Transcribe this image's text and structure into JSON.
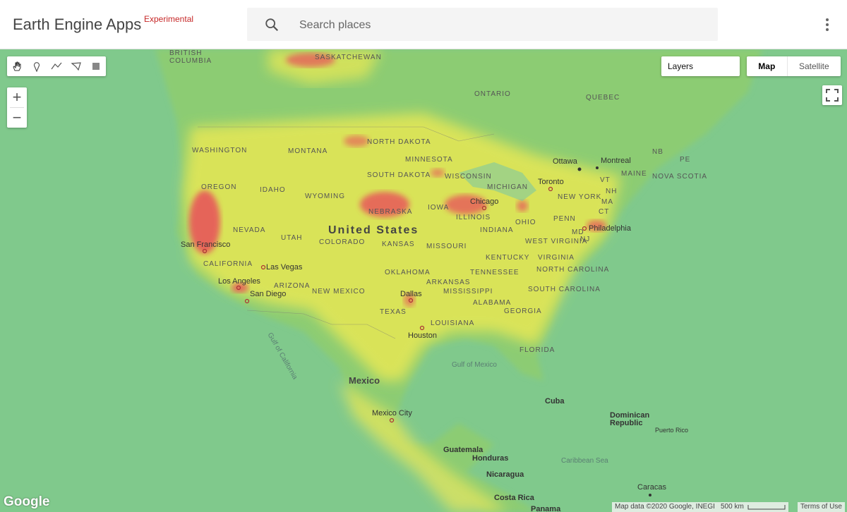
{
  "app": {
    "title": "Earth Engine Apps",
    "badge": "Experimental"
  },
  "search": {
    "placeholder": "Search places"
  },
  "controls": {
    "layers_label": "Layers",
    "map_type": {
      "map": "Map",
      "satellite": "Satellite",
      "selected": "Map"
    },
    "zoom_in": "+",
    "zoom_out": "−"
  },
  "draw_tools": [
    "hand-icon",
    "marker-icon",
    "polyline-icon",
    "polygon-icon",
    "rectangle-icon"
  ],
  "map": {
    "region_labels": {
      "british_columbia": "BRITISH\nCOLUMBIA",
      "saskatchewan": "SASKATCHEWAN",
      "ontario": "ONTARIO",
      "quebec": "QUEBEC",
      "washington": "WASHINGTON",
      "montana": "MONTANA",
      "north_dakota": "NORTH\nDAKOTA",
      "minnesota": "MINNESOTA",
      "oregon": "OREGON",
      "idaho": "IDAHO",
      "south_dakota": "SOUTH\nDAKOTA",
      "wisconsin": "WISCONSIN",
      "michigan": "MICHIGAN",
      "wyoming": "WYOMING",
      "nebraska": "NEBRASKA",
      "iowa": "IOWA",
      "illinois": "ILLINOIS",
      "indiana": "INDIANA",
      "ohio": "OHIO",
      "nevada": "NEVADA",
      "utah": "UTAH",
      "colorado": "COLORADO",
      "kansas": "KANSAS",
      "missouri": "MISSOURI",
      "california": "CALIFORNIA",
      "arizona": "ARIZONA",
      "new_mexico": "NEW MEXICO",
      "oklahoma": "OKLAHOMA",
      "arkansas": "ARKANSAS",
      "tennessee": "TENNESSEE",
      "kentucky": "KENTUCKY",
      "west_virginia": "WEST\nVIRGINIA",
      "virginia": "VIRGINIA",
      "north_carolina": "NORTH\nCAROLINA",
      "south_carolina": "SOUTH\nCAROLINA",
      "mississippi": "MISSISSIPPI",
      "alabama": "ALABAMA",
      "georgia": "GEORGIA",
      "texas": "TEXAS",
      "louisiana": "LOUISIANA",
      "florida": "FLORIDA",
      "penn": "PENN",
      "new_york": "NEW YORK",
      "vt": "VT",
      "nh": "NH",
      "maine": "MAINE",
      "ma": "MA",
      "ct": "CT",
      "nb": "NB",
      "pe": "PE",
      "nova_scotia": "NOVA SCOTIA",
      "md": "MD",
      "nj": "NJ"
    },
    "cities": {
      "ottawa": "Ottawa",
      "montreal": "Montreal",
      "toronto": "Toronto",
      "chicago": "Chicago",
      "philadelphia": "Philadelphia",
      "san_francisco": "San Francisco",
      "las_vegas": "Las Vegas",
      "los_angeles": "Los Angeles",
      "san_diego": "San Diego",
      "dallas": "Dallas",
      "houston": "Houston",
      "mexico_city": "Mexico City",
      "guatemala": "Guatemala",
      "honduras": "Honduras",
      "nicaragua": "Nicaragua",
      "costa_rica": "Costa Rica",
      "panama": "Panama",
      "cuba": "Cuba",
      "dominican_republic": "Dominican\nRepublic",
      "puerto_rico": "Puerto Rico",
      "caracas": "Caracas"
    },
    "countries": {
      "united_states": "United States",
      "mexico": "Mexico"
    },
    "seas": {
      "gulf_of_california": "Gulf of California",
      "gulf_of_mexico": "Gulf of\nMexico",
      "caribbean_sea": "Caribbean Sea"
    }
  },
  "footer": {
    "google": "Google",
    "map_data": "Map data ©2020 Google, INEGI",
    "scale": "500 km",
    "terms": "Terms of Use"
  },
  "colors": {
    "accent_badge": "#c62828",
    "low": "#7cc68a",
    "mid": "#e6e85a",
    "high": "#e8505a"
  }
}
